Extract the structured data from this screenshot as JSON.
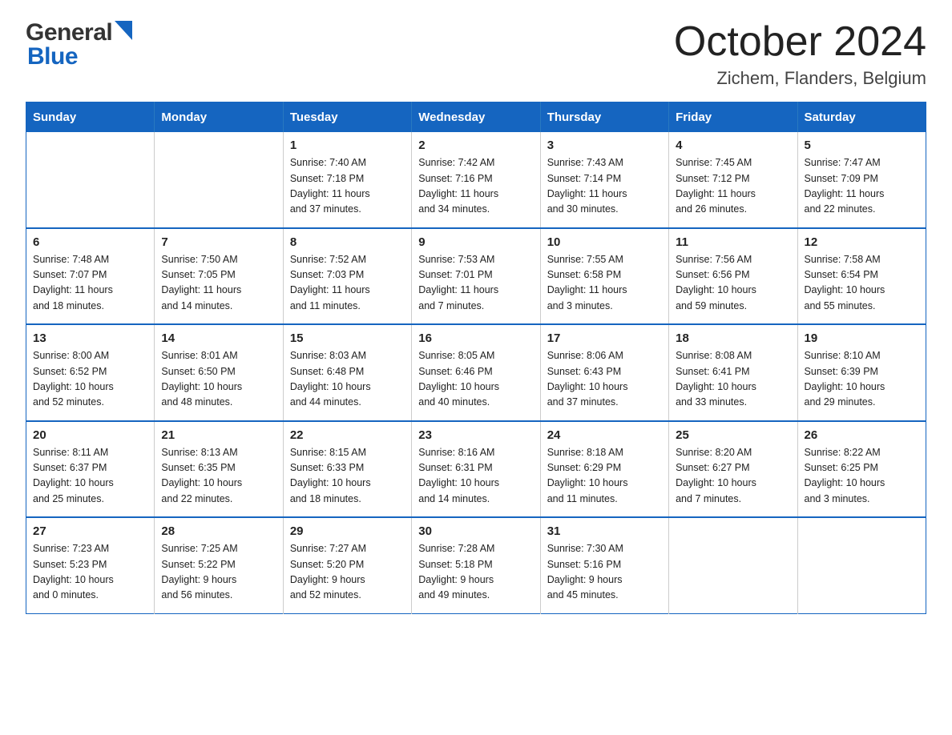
{
  "header": {
    "month": "October 2024",
    "location": "Zichem, Flanders, Belgium",
    "logo_general": "General",
    "logo_blue": "Blue"
  },
  "days_of_week": [
    "Sunday",
    "Monday",
    "Tuesday",
    "Wednesday",
    "Thursday",
    "Friday",
    "Saturday"
  ],
  "weeks": [
    [
      {
        "day": "",
        "info": ""
      },
      {
        "day": "",
        "info": ""
      },
      {
        "day": "1",
        "info": "Sunrise: 7:40 AM\nSunset: 7:18 PM\nDaylight: 11 hours\nand 37 minutes."
      },
      {
        "day": "2",
        "info": "Sunrise: 7:42 AM\nSunset: 7:16 PM\nDaylight: 11 hours\nand 34 minutes."
      },
      {
        "day": "3",
        "info": "Sunrise: 7:43 AM\nSunset: 7:14 PM\nDaylight: 11 hours\nand 30 minutes."
      },
      {
        "day": "4",
        "info": "Sunrise: 7:45 AM\nSunset: 7:12 PM\nDaylight: 11 hours\nand 26 minutes."
      },
      {
        "day": "5",
        "info": "Sunrise: 7:47 AM\nSunset: 7:09 PM\nDaylight: 11 hours\nand 22 minutes."
      }
    ],
    [
      {
        "day": "6",
        "info": "Sunrise: 7:48 AM\nSunset: 7:07 PM\nDaylight: 11 hours\nand 18 minutes."
      },
      {
        "day": "7",
        "info": "Sunrise: 7:50 AM\nSunset: 7:05 PM\nDaylight: 11 hours\nand 14 minutes."
      },
      {
        "day": "8",
        "info": "Sunrise: 7:52 AM\nSunset: 7:03 PM\nDaylight: 11 hours\nand 11 minutes."
      },
      {
        "day": "9",
        "info": "Sunrise: 7:53 AM\nSunset: 7:01 PM\nDaylight: 11 hours\nand 7 minutes."
      },
      {
        "day": "10",
        "info": "Sunrise: 7:55 AM\nSunset: 6:58 PM\nDaylight: 11 hours\nand 3 minutes."
      },
      {
        "day": "11",
        "info": "Sunrise: 7:56 AM\nSunset: 6:56 PM\nDaylight: 10 hours\nand 59 minutes."
      },
      {
        "day": "12",
        "info": "Sunrise: 7:58 AM\nSunset: 6:54 PM\nDaylight: 10 hours\nand 55 minutes."
      }
    ],
    [
      {
        "day": "13",
        "info": "Sunrise: 8:00 AM\nSunset: 6:52 PM\nDaylight: 10 hours\nand 52 minutes."
      },
      {
        "day": "14",
        "info": "Sunrise: 8:01 AM\nSunset: 6:50 PM\nDaylight: 10 hours\nand 48 minutes."
      },
      {
        "day": "15",
        "info": "Sunrise: 8:03 AM\nSunset: 6:48 PM\nDaylight: 10 hours\nand 44 minutes."
      },
      {
        "day": "16",
        "info": "Sunrise: 8:05 AM\nSunset: 6:46 PM\nDaylight: 10 hours\nand 40 minutes."
      },
      {
        "day": "17",
        "info": "Sunrise: 8:06 AM\nSunset: 6:43 PM\nDaylight: 10 hours\nand 37 minutes."
      },
      {
        "day": "18",
        "info": "Sunrise: 8:08 AM\nSunset: 6:41 PM\nDaylight: 10 hours\nand 33 minutes."
      },
      {
        "day": "19",
        "info": "Sunrise: 8:10 AM\nSunset: 6:39 PM\nDaylight: 10 hours\nand 29 minutes."
      }
    ],
    [
      {
        "day": "20",
        "info": "Sunrise: 8:11 AM\nSunset: 6:37 PM\nDaylight: 10 hours\nand 25 minutes."
      },
      {
        "day": "21",
        "info": "Sunrise: 8:13 AM\nSunset: 6:35 PM\nDaylight: 10 hours\nand 22 minutes."
      },
      {
        "day": "22",
        "info": "Sunrise: 8:15 AM\nSunset: 6:33 PM\nDaylight: 10 hours\nand 18 minutes."
      },
      {
        "day": "23",
        "info": "Sunrise: 8:16 AM\nSunset: 6:31 PM\nDaylight: 10 hours\nand 14 minutes."
      },
      {
        "day": "24",
        "info": "Sunrise: 8:18 AM\nSunset: 6:29 PM\nDaylight: 10 hours\nand 11 minutes."
      },
      {
        "day": "25",
        "info": "Sunrise: 8:20 AM\nSunset: 6:27 PM\nDaylight: 10 hours\nand 7 minutes."
      },
      {
        "day": "26",
        "info": "Sunrise: 8:22 AM\nSunset: 6:25 PM\nDaylight: 10 hours\nand 3 minutes."
      }
    ],
    [
      {
        "day": "27",
        "info": "Sunrise: 7:23 AM\nSunset: 5:23 PM\nDaylight: 10 hours\nand 0 minutes."
      },
      {
        "day": "28",
        "info": "Sunrise: 7:25 AM\nSunset: 5:22 PM\nDaylight: 9 hours\nand 56 minutes."
      },
      {
        "day": "29",
        "info": "Sunrise: 7:27 AM\nSunset: 5:20 PM\nDaylight: 9 hours\nand 52 minutes."
      },
      {
        "day": "30",
        "info": "Sunrise: 7:28 AM\nSunset: 5:18 PM\nDaylight: 9 hours\nand 49 minutes."
      },
      {
        "day": "31",
        "info": "Sunrise: 7:30 AM\nSunset: 5:16 PM\nDaylight: 9 hours\nand 45 minutes."
      },
      {
        "day": "",
        "info": ""
      },
      {
        "day": "",
        "info": ""
      }
    ]
  ]
}
